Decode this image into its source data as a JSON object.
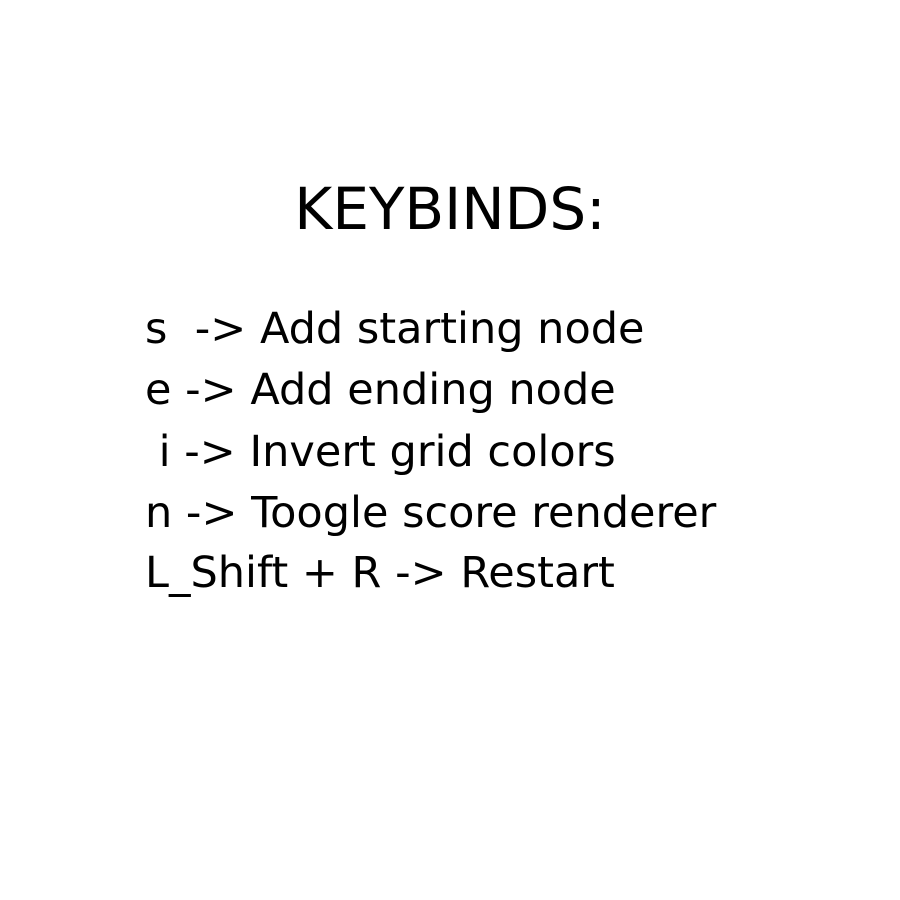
{
  "title": "KEYBINDS:",
  "keybinds": [
    "s  -> Add starting node",
    "e -> Add ending node",
    " i -> Invert grid colors",
    "n -> Toogle score renderer",
    "L_Shift + R -> Restart"
  ],
  "colors": {
    "background": "#ffffff",
    "text": "#000000"
  }
}
